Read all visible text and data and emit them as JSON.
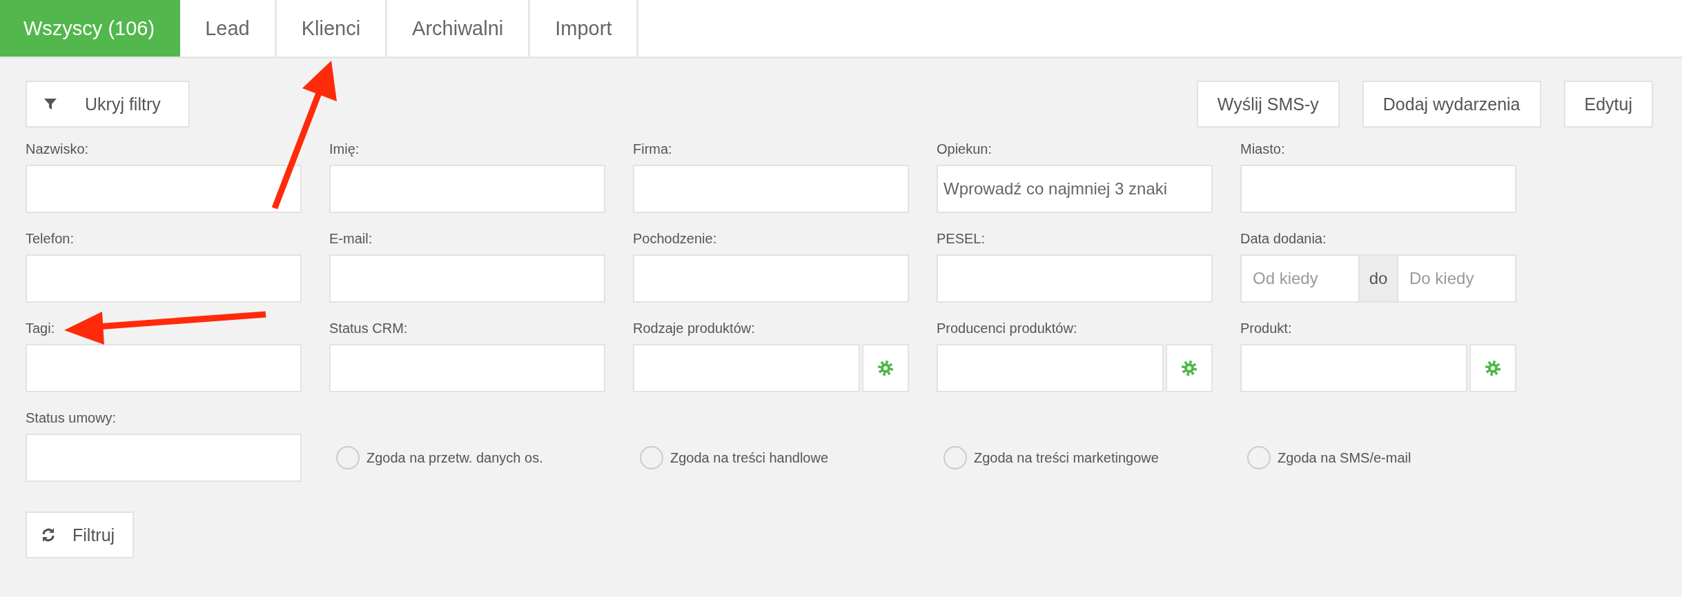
{
  "tabs": [
    {
      "label": "Wszyscy (106)",
      "selected": true
    },
    {
      "label": "Lead",
      "selected": false
    },
    {
      "label": "Klienci",
      "selected": false
    },
    {
      "label": "Archiwalni",
      "selected": false
    },
    {
      "label": "Import",
      "selected": false
    }
  ],
  "toolbar": {
    "hide_filters": "Ukryj filtry",
    "actions": [
      "Wyślij SMS-y",
      "Dodaj wydarzenia",
      "Edytuj"
    ]
  },
  "filters": [
    {
      "kind": "text",
      "label": "Nazwisko:"
    },
    {
      "kind": "text",
      "label": "Imię:"
    },
    {
      "kind": "text",
      "label": "Firma:"
    },
    {
      "kind": "text",
      "label": "Opiekun:",
      "placeholder": "Wprowadź co najmniej 3 znaki"
    },
    {
      "kind": "text",
      "label": "Miasto:"
    },
    {
      "kind": "text",
      "label": "Telefon:"
    },
    {
      "kind": "text",
      "label": "E-mail:"
    },
    {
      "kind": "text",
      "label": "Pochodzenie:"
    },
    {
      "kind": "text",
      "label": "PESEL:"
    },
    {
      "kind": "daterange",
      "label": "Data dodania:",
      "from_placeholder": "Od kiedy",
      "separator": "do",
      "to_placeholder": "Do kiedy"
    },
    {
      "kind": "text",
      "label": "Tagi:"
    },
    {
      "kind": "text",
      "label": "Status CRM:"
    },
    {
      "kind": "gear",
      "label": "Rodzaje produktów:"
    },
    {
      "kind": "gear",
      "label": "Producenci produktów:"
    },
    {
      "kind": "gear",
      "label": "Produkt:"
    },
    {
      "kind": "text",
      "label": "Status umowy:"
    },
    {
      "kind": "consent",
      "label": "Zgoda na przetw. danych os.",
      "checked": false
    },
    {
      "kind": "consent",
      "label": "Zgoda na treści handlowe",
      "checked": false
    },
    {
      "kind": "consent",
      "label": "Zgoda na treści marketingowe",
      "checked": false
    },
    {
      "kind": "consent",
      "label": "Zgoda na SMS/e-mail",
      "checked": false
    }
  ],
  "submit": "Filtruj"
}
